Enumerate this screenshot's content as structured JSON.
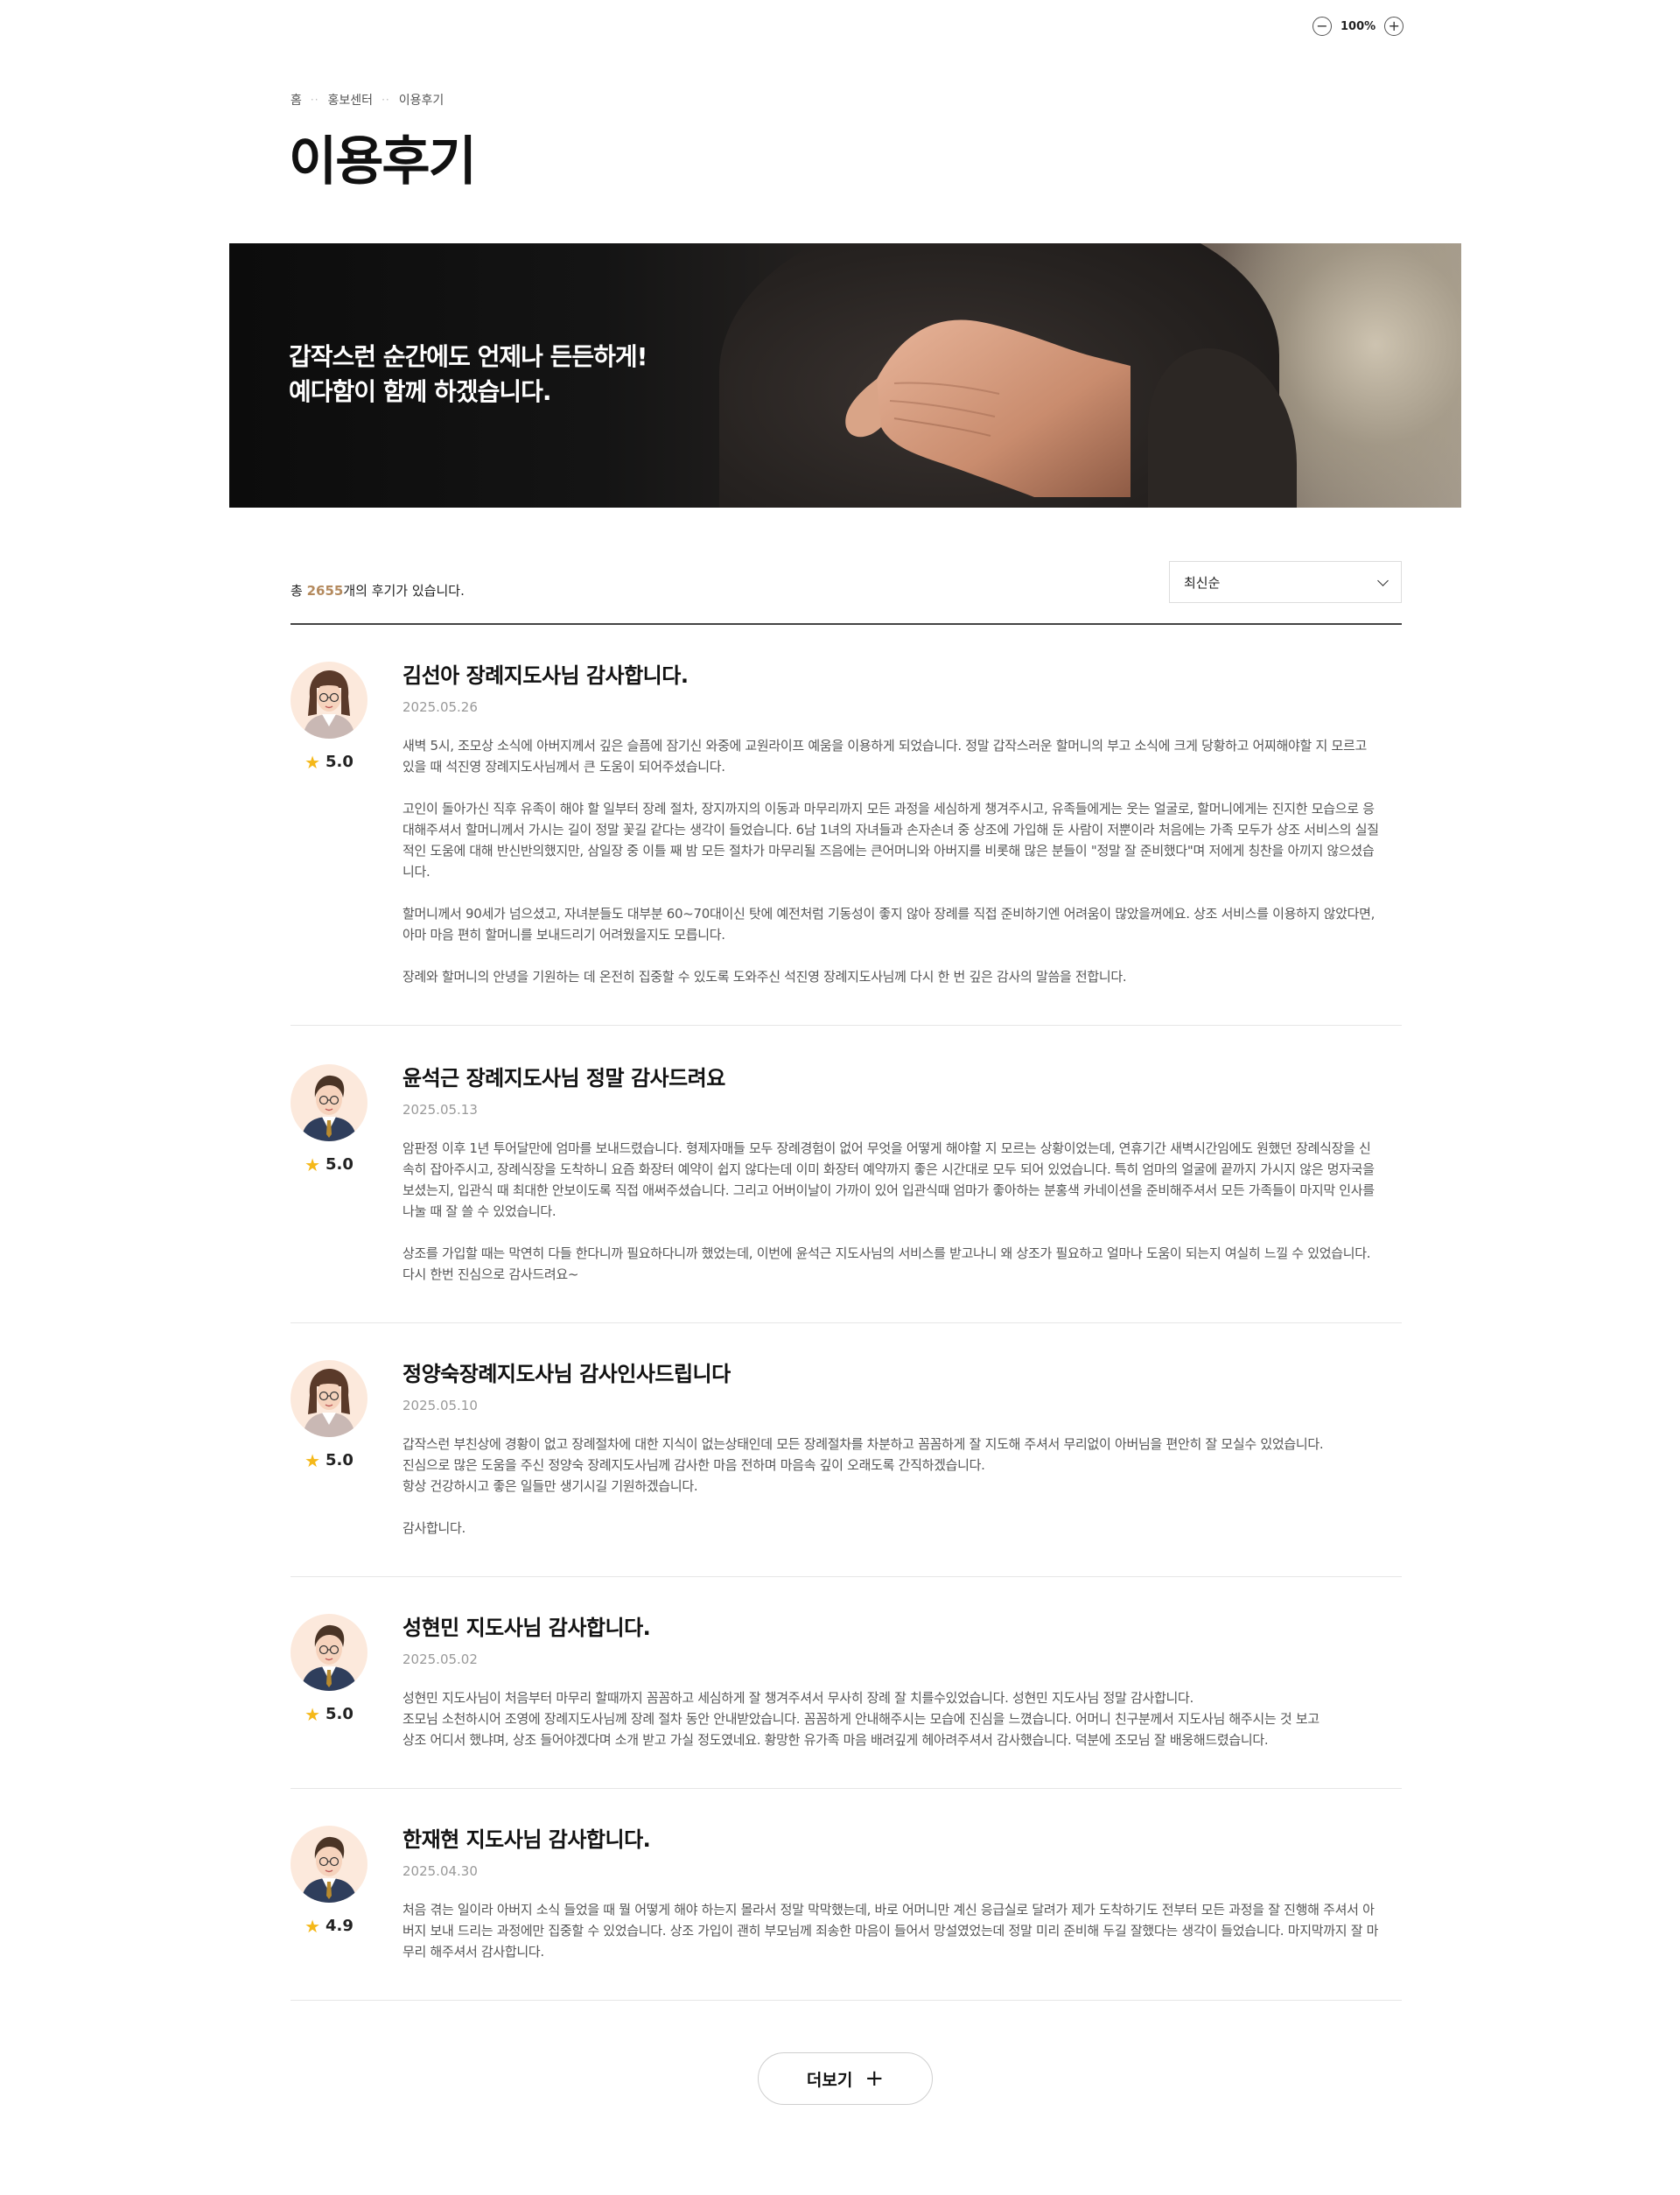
{
  "zoom": {
    "minus_icon": "zoom-out-icon",
    "plus_icon": "zoom-in-icon",
    "level": "100%"
  },
  "breadcrumb": [
    "홈",
    "홍보센터",
    "이용후기"
  ],
  "page_title": "이용후기",
  "hero": {
    "line1": "갑작스런 순간에도 언제나 든든하게!",
    "line2": "예다함이 함께 하겠습니다."
  },
  "summary": {
    "prefix": "총 ",
    "count": "2655",
    "suffix": "개의 후기가 있습니다."
  },
  "sort": {
    "selected": "최신순"
  },
  "reviews": [
    {
      "avatar": "female",
      "rating": "5.0",
      "title": "김선아 장례지도사님 감사합니다.",
      "date": "2025.05.26",
      "text": "새벽 5시, 조모상 소식에 아버지께서 깊은 슬픔에 잠기신 와중에 교원라이프 예움을 이용하게 되었습니다. 정말 갑작스러운 할머니의 부고 소식에 크게 당황하고 어찌해야할 지 모르고\n있을 때 석진영 장례지도사님께서 큰 도움이 되어주셨습니다.\n\n고인이 돌아가신 직후 유족이 해야 할 일부터 장례 절차, 장지까지의 이동과 마무리까지 모든 과정을 세심하게 챙겨주시고, 유족들에게는 웃는 얼굴로, 할머니에게는 진지한 모습으로 응\n대해주셔서 할머니께서 가시는 길이 정말 꽃길 같다는 생각이 들었습니다. 6남 1녀의 자녀들과 손자손녀 중 상조에 가입해 둔 사람이 저뿐이라 처음에는 가족 모두가 상조 서비스의 실질\n적인 도움에 대해 반신반의했지만, 삼일장 중 이틀 째 밤 모든 절차가 마무리될 즈음에는 큰어머니와 아버지를 비롯해 많은 분들이 \"정말 잘 준비했다\"며 저에게 칭찬을 아끼지 않으셨습\n니다.\n\n할머니께서 90세가 넘으셨고, 자녀분들도 대부분 60~70대이신 탓에 예전처럼 기동성이 좋지 않아 장례를 직접 준비하기엔 어려움이 많았을꺼에요. 상조 서비스를 이용하지 않았다면,\n아마 마음 편히 할머니를 보내드리기 어려웠을지도 모릅니다.\n\n장례와 할머니의 안녕을 기원하는 데 온전히 집중할 수 있도록 도와주신 석진영 장례지도사님께 다시 한 번 깊은 감사의 말씀을 전합니다."
    },
    {
      "avatar": "male",
      "rating": "5.0",
      "title": "윤석근 장례지도사님 정말 감사드려요",
      "date": "2025.05.13",
      "text": "암판정 이후 1년 투어달만에 엄마를 보내드렸습니다. 형제자매들 모두 장례경험이 없어 무엇을 어떻게 해야할 지 모르는 상황이었는데, 연휴기간 새벽시간임에도 원했던 장례식장을 신\n속히 잡아주시고, 장례식장을 도착하니 요즘 화장터 예약이 쉽지 않다는데 이미 화장터 예약까지 좋은 시간대로 모두 되어 있었습니다. 특히 엄마의 얼굴에 끝까지 가시지 않은 멍자국을\n보셨는지, 입관식 때 최대한 안보이도록 직접 애써주셨습니다. 그리고 어버이날이 가까이 있어 입관식때 엄마가 좋아하는 분홍색 카네이션을 준비해주셔서 모든 가족들이 마지막 인사를\n나눌 때 잘 쓸 수 있었습니다.\n\n상조를 가입할 때는 막연히 다들 한다니까 필요하다니까 했었는데, 이번에 윤석근 지도사님의 서비스를 받고나니 왜 상조가 필요하고 얼마나 도움이 되는지 여실히 느낄 수 있었습니다.\n다시 한번 진심으로 감사드려요~"
    },
    {
      "avatar": "female",
      "rating": "5.0",
      "title": "정양숙장례지도사님 감사인사드립니다",
      "date": "2025.05.10",
      "text": "갑작스런 부친상에 경황이 없고 장례절차에 대한 지식이 없는상태인데 모든 장례절차를 차분하고 꼼꼼하게 잘 지도해 주셔서 무리없이 아버님을 편안히 잘 모실수 있었습니다.\n진심으로 많은 도움을 주신 정양숙 장례지도사님께 감사한 마음 전하며 마음속 깊이 오래도록 간직하겠습니다.\n항상 건강하시고 좋은 일들만 생기시길 기원하겠습니다.\n\n감사합니다."
    },
    {
      "avatar": "male",
      "rating": "5.0",
      "title": "성현민 지도사님 감사합니다.",
      "date": "2025.05.02",
      "text": "성현민 지도사님이 처음부터 마무리 할때까지 꼼꼼하고 세심하게 잘 챙겨주셔서 무사히 장례 잘 치를수있었습니다. 성현민 지도사님 정말 감사합니다.\n조모님 소천하시어 조영에 장례지도사님께 장례 절차 동안 안내받았습니다. 꼼꼼하게 안내해주시는 모습에 진심을 느꼈습니다. 어머니 친구분께서 지도사님 해주시는 것 보고\n상조 어디서 했냐며, 상조 들어야겠다며 소개 받고 가실 정도였네요. 황망한 유가족 마음 배려깊게 헤아려주셔서 감사했습니다. 덕분에 조모님 잘 배웅해드렸습니다."
    },
    {
      "avatar": "male",
      "rating": "4.9",
      "title": "한재현 지도사님 감사합니다.",
      "date": "2025.04.30",
      "text": "처음 겪는 일이라 아버지 소식 들었을 때 뭘 어떻게 해야 하는지 몰라서 정말 막막했는데, 바로 어머니만 계신 응급실로 달려가 제가 도착하기도 전부터 모든 과정을 잘 진행해 주셔서 아\n버지 보내 드리는 과정에만 집중할 수 있었습니다. 상조 가입이 괜히 부모님께 죄송한 마음이 들어서 망설였었는데 정말 미리 준비해 두길 잘했다는 생각이 들었습니다. 마지막까지 잘 마\n무리 해주셔서 감사합니다."
    }
  ],
  "more_button": {
    "label": "더보기",
    "icon": "plus-icon"
  },
  "colors": {
    "accent_count": "#b48a5e",
    "star": "#f5b819"
  }
}
